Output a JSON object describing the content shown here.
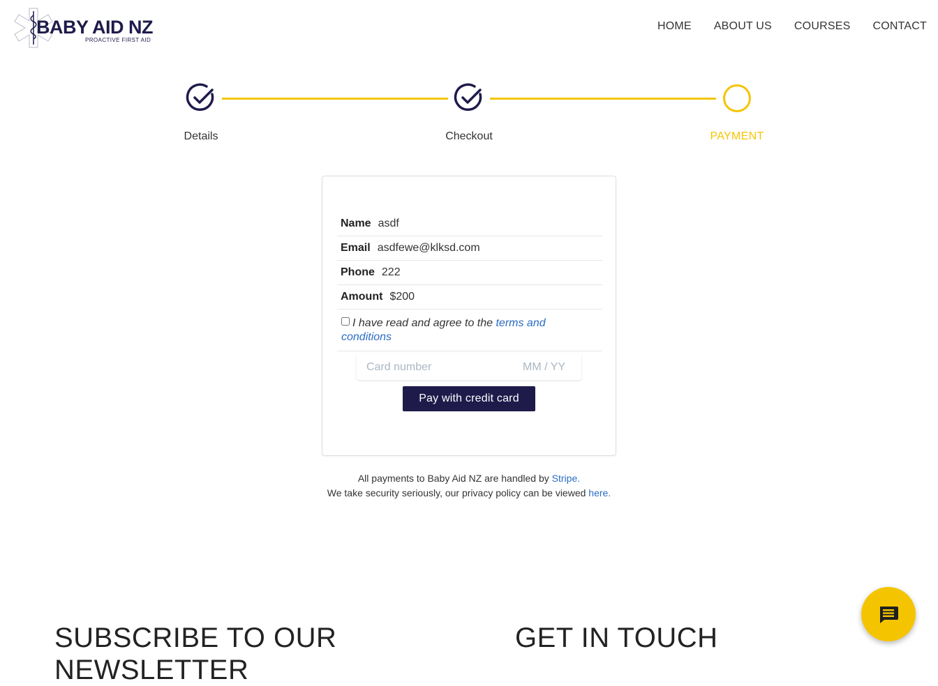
{
  "brand": {
    "name": "BABY AID NZ",
    "tagline": "PROACTIVE FIRST AID",
    "colors": {
      "primary": "#1e1b4b",
      "accent": "#f5c400",
      "link": "#2b6cc4"
    }
  },
  "nav": {
    "items": [
      {
        "label": "HOME"
      },
      {
        "label": "ABOUT US"
      },
      {
        "label": "COURSES"
      },
      {
        "label": "CONTACT"
      }
    ]
  },
  "stepper": {
    "steps": [
      {
        "label": "Details",
        "state": "complete",
        "icon": "check-circle-icon"
      },
      {
        "label": "Checkout",
        "state": "complete",
        "icon": "check-circle-icon"
      },
      {
        "label": "PAYMENT",
        "state": "active",
        "icon": "circle-icon"
      }
    ]
  },
  "summary": {
    "rows": [
      {
        "label": "Name",
        "value": "asdf"
      },
      {
        "label": "Email",
        "value": "asdfewe@klksd.com"
      },
      {
        "label": "Phone",
        "value": "222"
      },
      {
        "label": "Amount",
        "value": "$200"
      }
    ],
    "terms": {
      "text": "I have read and agree to the ",
      "link": "terms and conditions",
      "checked": false
    }
  },
  "payment": {
    "card_number_placeholder": "Card number",
    "expiry_placeholder": "MM / YY",
    "pay_button": "Pay with credit card"
  },
  "footnote": {
    "line1_text": "All payments to Baby Aid NZ are handled by ",
    "line1_link": "Stripe.",
    "line2_text": "We take security seriously, our privacy policy can be viewed ",
    "line2_link": "here."
  },
  "sections": {
    "subscribe_title": "SUBSCRIBE TO OUR NEWSLETTER",
    "contact_title": "GET IN TOUCH"
  },
  "chat": {
    "icon": "chat-message-icon"
  }
}
